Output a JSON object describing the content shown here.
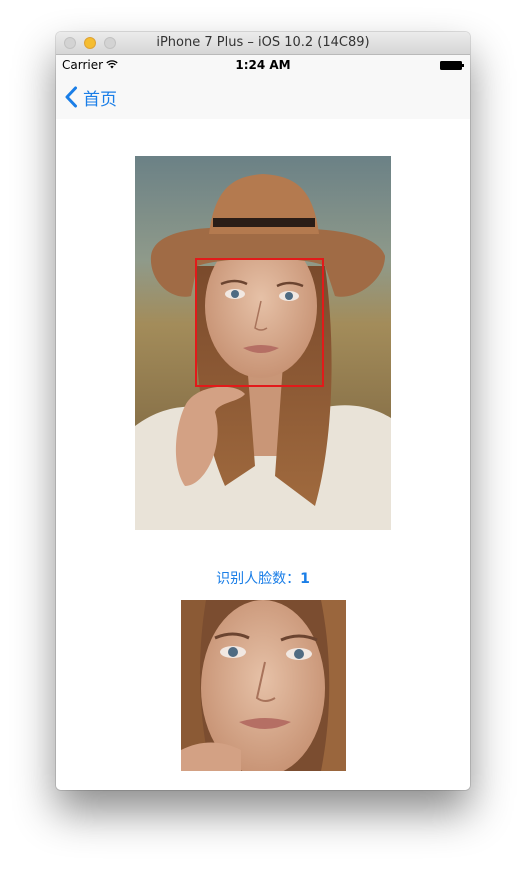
{
  "window": {
    "title": "iPhone 7 Plus – iOS 10.2 (14C89)"
  },
  "status_bar": {
    "carrier": "Carrier",
    "time": "1:24 AM",
    "wifi_icon": "wifi-icon",
    "battery_icon": "battery-icon"
  },
  "nav": {
    "back_label": "首页",
    "back_icon": "chevron-left-icon"
  },
  "face_detection": {
    "count_label": "识别人脸数：",
    "count_value": "1",
    "box_color": "#e21a1a"
  },
  "colors": {
    "accent": "#1a7ee7"
  }
}
